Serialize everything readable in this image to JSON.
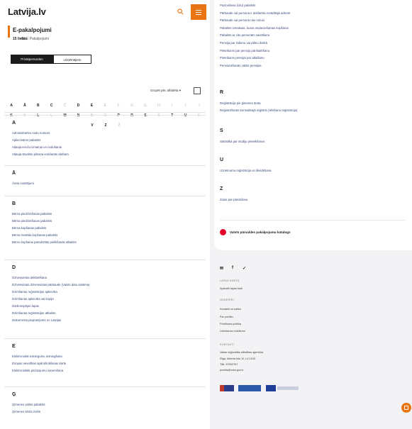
{
  "header": {
    "logo_text": "Latvija.lv",
    "search_icon": "search-icon",
    "menu_icon": "menu-icon"
  },
  "page": {
    "title": "E-pakalpojumi",
    "count_num": "15 lietas",
    "count_text": "83 E Pakalpojumi"
  },
  "tabs": [
    {
      "label": "Privātpersonām"
    },
    {
      "label": "Uzņēmējiem"
    }
  ],
  "group_by": {
    "label": "Grupēt pēc alfabēta ▾"
  },
  "alphabet": {
    "row1": [
      "A",
      "Ā",
      "B",
      "C",
      "Č",
      "D",
      "E",
      "Ē",
      "F",
      "G",
      "Ģ",
      "H",
      "I",
      "Ī",
      "J"
    ],
    "row2": [
      "K",
      "Ķ",
      "L",
      "Ļ",
      "M",
      "N",
      "Ņ",
      "O",
      "P",
      "R",
      "S",
      "Š",
      "T",
      "U",
      "Ū"
    ],
    "row3": [
      "V",
      "Z",
      "Ž"
    ]
  },
  "left_sections": [
    {
      "letter": "A",
      "items": [
        "Administratīvo sodu numurs",
        "Apliecināms pabalsts",
        "Atļauja ieroču izmaiņai un nodošanai",
        "Atļauja ārvalstu pilsoņa ierašanās darbam"
      ]
    },
    {
      "letter": "Ā",
      "items": [
        "Ārsta nosūtījumi"
      ]
    },
    {
      "letter": "B",
      "items": [
        "Bērna piedzimšanas pabalsts",
        "Bērna piedzimšanas pabalsts",
        "Bērna kopšanas pabalsts",
        "Bērna invalīda kopšanas pabalsts",
        "Bērnu kopšanai paredzētās pielikšanās atbalsts"
      ]
    },
    {
      "letter": "D",
      "items": [
        "Dzīvesvietas deklarēšana",
        "Dzīvesvietas dzīvesvietas pārbaude (Valsts datu sistēma)",
        "Dzimšanas reģistrācijas apliecība",
        "Dzimšanas apliecība vai kopija",
        "Darbnespējas lapas",
        "Dzimšanas reģistrācijas atbalsts",
        "Dokumenta pieprasījums no Latvijas"
      ]
    },
    {
      "letter": "E",
      "items": [
        "Elektroniskā iesniegumu iesniegšana",
        "Eiropas veselības apdrošināšanas karte",
        "Elektroniskās paziņojumu saņemšana"
      ]
    },
    {
      "letter": "Ģ",
      "items": [
        "Ģimenes valsts pabalsts",
        "Ģimenes ārsta izvēle"
      ]
    }
  ],
  "right_top_items": [
    "Paziņošana (citu) pabalsts",
    "Pārbaude vai persona ir deklarēta norādītajā adresē",
    "Pārbaude vai persona nav mirusi",
    "Pabalsts izmaksas, kuras nepieciešamas kopšanai",
    "Pabalsts ar citu personām saistīšanu",
    "Pensija par izdienu vai plānu darbā",
    "Pieteikums par pensiju pārskaitīšanu",
    "Pieteikums pensijai par atlaišanu",
    "Pensionēšanās valsts pensijas"
  ],
  "right_sections": [
    {
      "letter": "R",
      "items": [
        "Reģistrācija pie ģimenes ārsta",
        "Reģistrēšanās konsulārajā reģistrā (vēlēšanu reģistrācija)"
      ]
    },
    {
      "letter": "S",
      "items": [
        "Statistika par studiju pieteikšanos"
      ]
    },
    {
      "letter": "U",
      "items": [
        "Uzņēmuma reģistrācija un likvidēšana"
      ]
    },
    {
      "letter": "Z",
      "items": [
        "Ziņas par pārdošanu"
      ]
    }
  ],
  "catalog_link": "Valsts pārvaldes pakalpojumu katalogs",
  "footer": {
    "social": [
      "✉",
      "f",
      "✓"
    ],
    "label1": "LAPAS KARTE",
    "sitemap": "Apskatīt lapas karti",
    "label2": "NODERĪGI",
    "useful": [
      "Kontakti un saites",
      "Par portālu",
      "Privātuma politika",
      "Lietošanas noteikumi"
    ],
    "label3": "KONTAKTI",
    "contacts": [
      "Valsts reģionālās attīstības aģentūra",
      "Rīga, Alberta iela 10, LV-1010",
      "Tālr. 67502767",
      "portals@vraa.gov.lv"
    ]
  },
  "colors": {
    "accent": "#e87511",
    "brand_red": "#e4002b",
    "link": "#3b4a7a"
  }
}
